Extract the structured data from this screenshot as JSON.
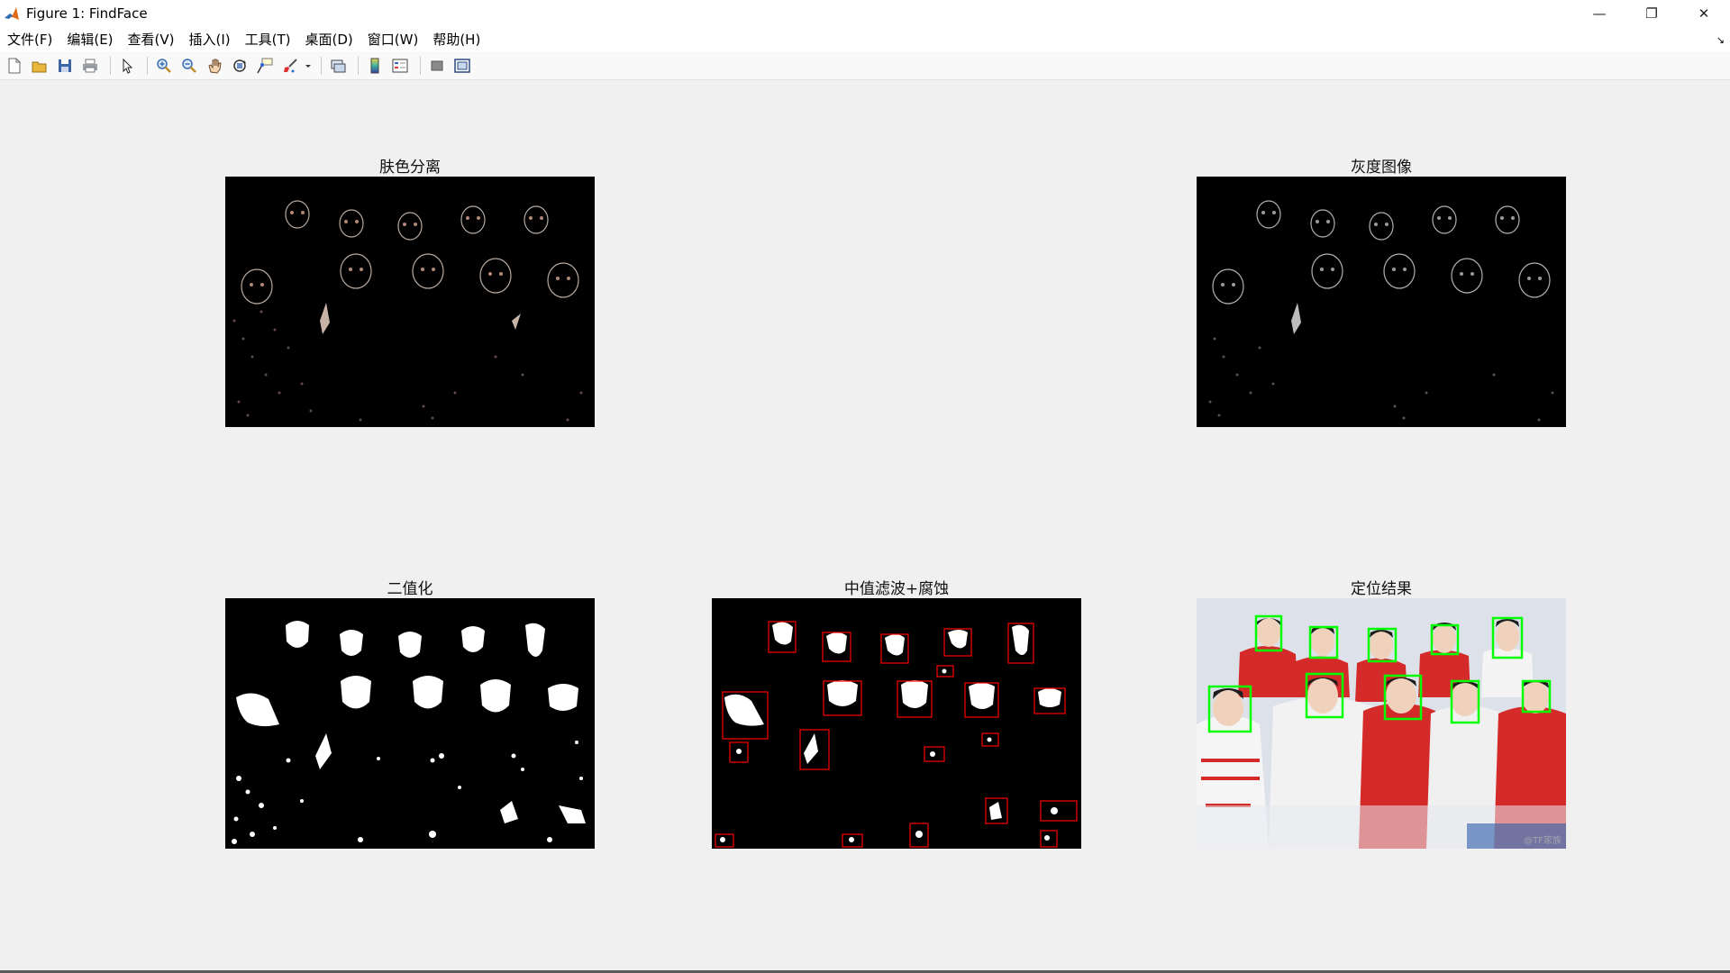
{
  "window": {
    "title": "Figure 1: FindFace",
    "controls": {
      "minimize": "—",
      "restore": "❐",
      "close": "✕"
    }
  },
  "menu": {
    "items": [
      "文件(F)",
      "编辑(E)",
      "查看(V)",
      "插入(I)",
      "工具(T)",
      "桌面(D)",
      "窗口(W)",
      "帮助(H)"
    ],
    "dock_arrow": "↘"
  },
  "toolbar": {
    "icons": [
      "new-figure-icon",
      "open-file-icon",
      "save-icon",
      "print-icon",
      "pointer-icon",
      "zoom-in-icon",
      "zoom-out-icon",
      "pan-icon",
      "rotate-3d-icon",
      "data-cursor-icon",
      "brush-icon",
      "link-plot-icon",
      "colorbar-icon",
      "legend-icon",
      "hide-plot-tools-icon",
      "show-plot-tools-icon"
    ]
  },
  "subplots": [
    {
      "title": "肤色分离",
      "type": "skin-separation"
    },
    {
      "title": "灰度图像",
      "type": "grayscale"
    },
    {
      "title": "二值化",
      "type": "binary"
    },
    {
      "title": "中值滤波+腐蚀",
      "type": "median-filter-erosion"
    },
    {
      "title": "定位结果",
      "type": "localization-result"
    }
  ],
  "colors": {
    "background": "#f0f0f0",
    "detect_box": "#00ff00",
    "region_box": "#ff0000"
  }
}
